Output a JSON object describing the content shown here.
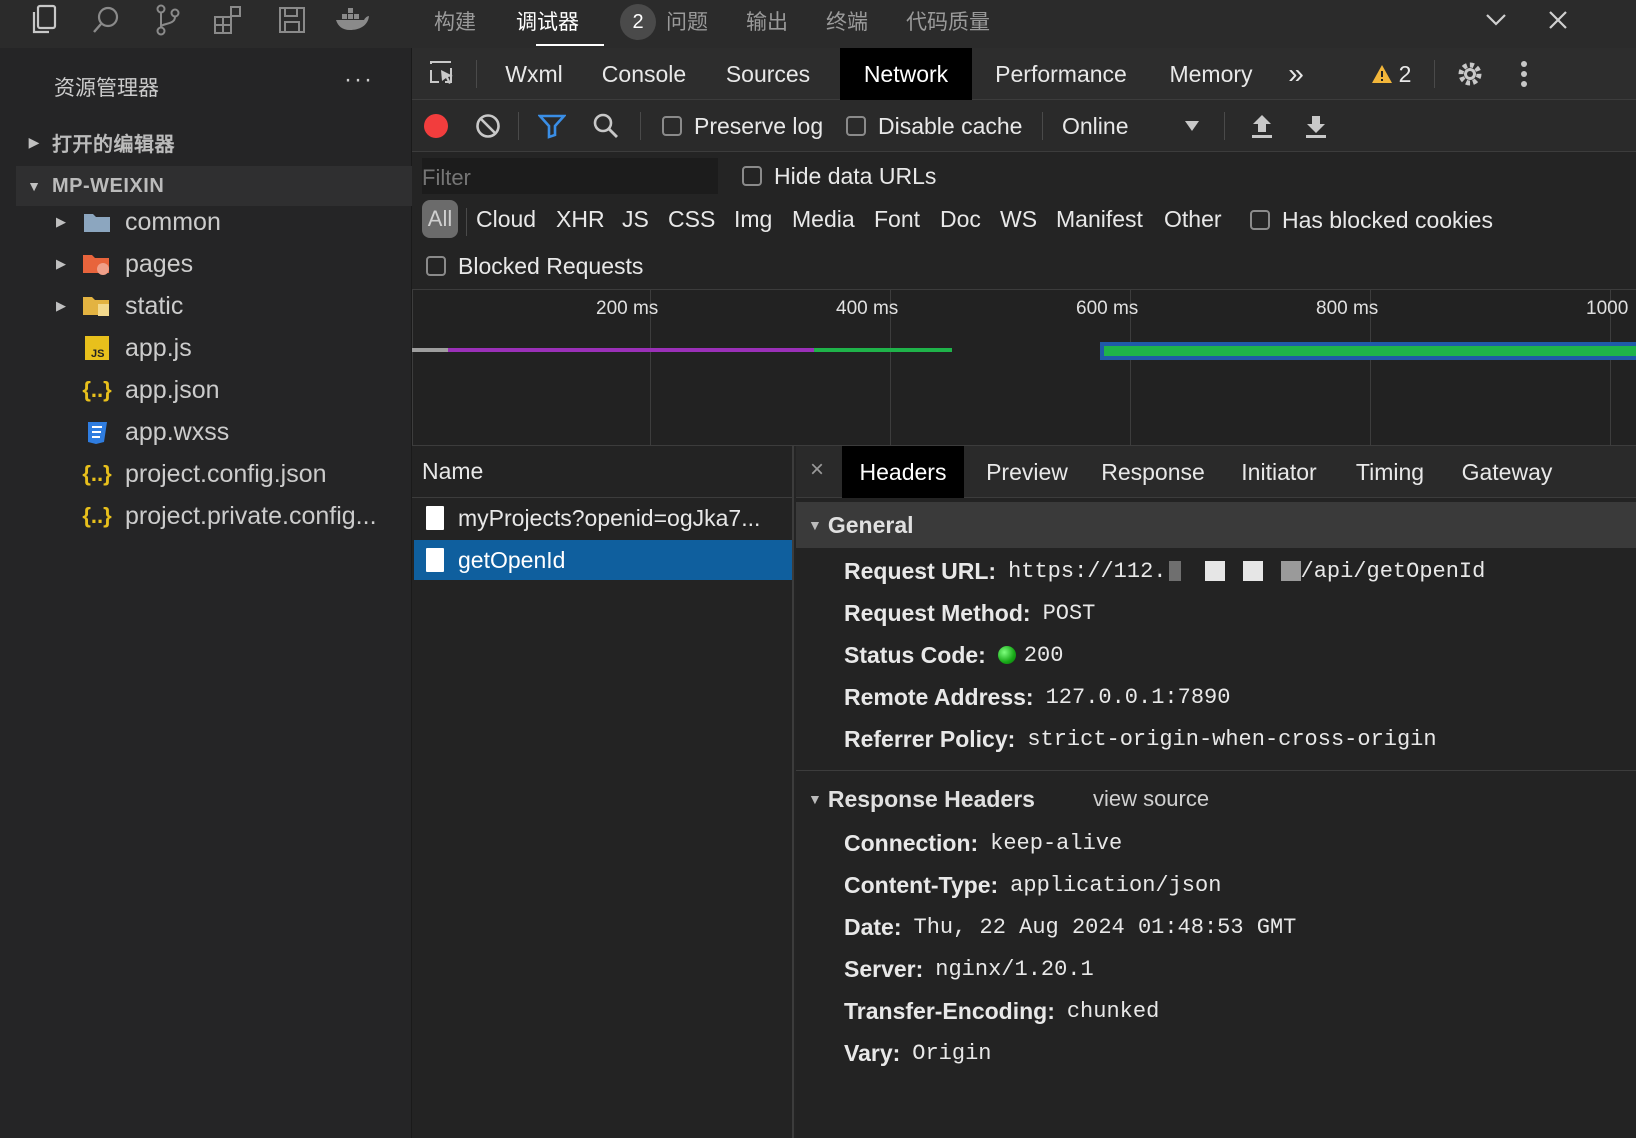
{
  "topbar": {
    "icons": [
      "explorer-icon",
      "search-icon",
      "source-control-icon",
      "extensions-icon",
      "save-icon",
      "docker-icon",
      "chevron-down-icon",
      "close-icon"
    ],
    "panel_tabs": [
      "构建",
      "调试器",
      "问题",
      "输出",
      "终端",
      "代码质量"
    ],
    "active_panel_tab": "调试器",
    "debugger_count": "2"
  },
  "explorer": {
    "title": "资源管理器",
    "more": "···",
    "open_editors_label": "打开的编辑器",
    "project_label": "MP-WEIXIN",
    "tree": [
      {
        "label": "common",
        "icon": "folder-icon",
        "expandable": true
      },
      {
        "label": "pages",
        "icon": "pages-folder-icon",
        "expandable": true
      },
      {
        "label": "static",
        "icon": "static-folder-icon",
        "expandable": true
      },
      {
        "label": "app.js",
        "icon": "js-file-icon",
        "expandable": false
      },
      {
        "label": "app.json",
        "icon": "json-file-icon",
        "expandable": false
      },
      {
        "label": "app.wxss",
        "icon": "css-file-icon",
        "expandable": false
      },
      {
        "label": "project.config.json",
        "icon": "json-file-icon",
        "expandable": false
      },
      {
        "label": "project.private.config...",
        "icon": "json-file-icon",
        "expandable": false
      }
    ]
  },
  "devtools": {
    "tabs": [
      "Wxml",
      "Console",
      "Sources",
      "Network",
      "Performance",
      "Memory"
    ],
    "active_tab": "Network",
    "more_tabs": "»",
    "warning_count": "2",
    "toolbar": {
      "preserve_log": "Preserve log",
      "disable_cache": "Disable cache",
      "throttling": "Online"
    },
    "filter": {
      "placeholder": "Filter",
      "hide_data_urls": "Hide data URLs",
      "types": [
        "All",
        "Cloud",
        "XHR",
        "JS",
        "CSS",
        "Img",
        "Media",
        "Font",
        "Doc",
        "WS",
        "Manifest",
        "Other"
      ],
      "has_blocked_cookies": "Has blocked cookies",
      "blocked_requests": "Blocked Requests"
    },
    "timeline": {
      "ticks": [
        "200 ms",
        "400 ms",
        "600 ms",
        "800 ms",
        "1000"
      ],
      "colors": {
        "purple": "#9b30b8",
        "green": "#1fb34a",
        "blue": "#1f5aa8"
      }
    },
    "requests": {
      "column": "Name",
      "rows": [
        "myProjects?openid=ogJka7...",
        "getOpenId"
      ],
      "selected": "getOpenId"
    },
    "details": {
      "close": "×",
      "tabs": [
        "Headers",
        "Preview",
        "Response",
        "Initiator",
        "Timing",
        "Gateway"
      ],
      "active_tab": "Headers",
      "general_title": "General",
      "general": [
        {
          "key": "Request URL:",
          "value_prefix": "https://112.",
          "value_suffix": "/api/getOpenId"
        },
        {
          "key": "Request Method:",
          "value": "POST"
        },
        {
          "key": "Status Code:",
          "value": "200"
        },
        {
          "key": "Remote Address:",
          "value": "127.0.0.1:7890"
        },
        {
          "key": "Referrer Policy:",
          "value": "strict-origin-when-cross-origin"
        }
      ],
      "response_headers_title": "Response Headers",
      "view_source": "view source",
      "response_headers": [
        {
          "key": "Connection:",
          "value": "keep-alive"
        },
        {
          "key": "Content-Type:",
          "value": "application/json"
        },
        {
          "key": "Date:",
          "value": "Thu, 22 Aug 2024 01:48:53 GMT"
        },
        {
          "key": "Server:",
          "value": "nginx/1.20.1"
        },
        {
          "key": "Transfer-Encoding:",
          "value": "chunked"
        },
        {
          "key": "Vary:",
          "value": "Origin"
        }
      ]
    }
  }
}
